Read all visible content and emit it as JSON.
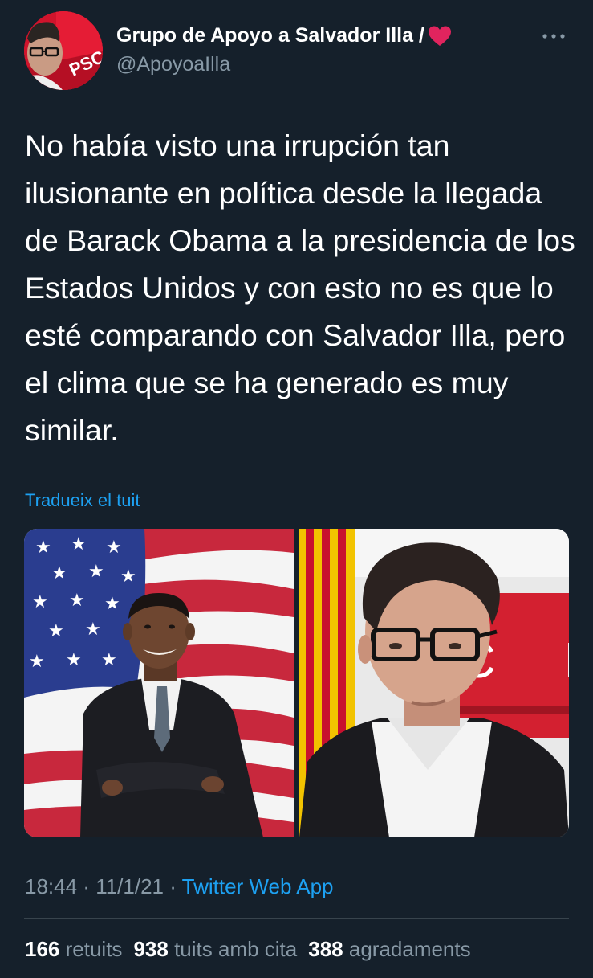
{
  "author": {
    "name": "Grupo de Apoyo a Salvador Illa /",
    "handle": "@ApoyoaIlla",
    "avatar_text": "PSC"
  },
  "tweet": {
    "text": "No había visto una irrupción tan ilusionante en política desde la llegada de Barack Obama a la presidencia de los Estados Unidos y con esto no es que lo esté comparando con Salvador Illa, pero el clima que se ha generado es muy similar.",
    "translate_label": "Tradueix el tuit"
  },
  "media": {
    "photo_right_sign": "C F"
  },
  "meta": {
    "time": "18:44",
    "separator": " · ",
    "date": "11/1/21",
    "source": "Twitter Web App"
  },
  "stats": {
    "retweets_count": "166",
    "retweets_label": "retuits",
    "quotes_count": "938",
    "quotes_label": "tuits amb cita",
    "likes_count": "388",
    "likes_label": "agradaments"
  },
  "colors": {
    "background": "#15202b",
    "text": "#ffffff",
    "secondary": "#8899a6",
    "accent": "#1da1f2",
    "heart": "#e0245e"
  }
}
